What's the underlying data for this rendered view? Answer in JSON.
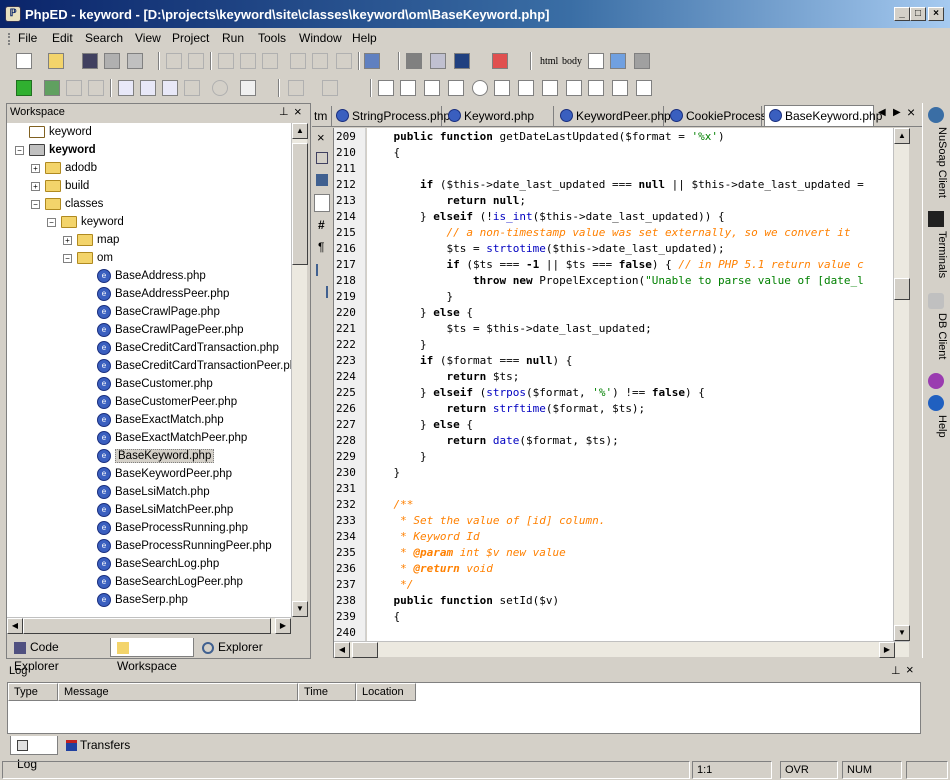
{
  "window": {
    "title": "PhpED - keyword - [D:\\projects\\keyword\\site\\classes\\keyword\\om\\BaseKeyword.php]",
    "min": "_",
    "max": "□",
    "close": "×"
  },
  "menu": [
    "File",
    "Edit",
    "Search",
    "View",
    "Project",
    "Run",
    "Tools",
    "Window",
    "Help"
  ],
  "toolbar_text": {
    "html": "html",
    "body": "body"
  },
  "workspace": {
    "title": "Workspace",
    "tree": [
      {
        "label": "keyword",
        "type": "root",
        "indent": 0
      },
      {
        "label": "keyword",
        "type": "project",
        "indent": 0,
        "bold": true
      },
      {
        "label": "adodb",
        "type": "folder",
        "indent": 1
      },
      {
        "label": "build",
        "type": "folder",
        "indent": 1
      },
      {
        "label": "classes",
        "type": "folder",
        "indent": 1
      },
      {
        "label": "keyword",
        "type": "folder",
        "indent": 2
      },
      {
        "label": "map",
        "type": "folder",
        "indent": 3
      },
      {
        "label": "om",
        "type": "folder",
        "indent": 3
      },
      {
        "label": "BaseAddress.php",
        "type": "file",
        "indent": 4
      },
      {
        "label": "BaseAddressPeer.php",
        "type": "file",
        "indent": 4
      },
      {
        "label": "BaseCrawlPage.php",
        "type": "file",
        "indent": 4
      },
      {
        "label": "BaseCrawlPagePeer.php",
        "type": "file",
        "indent": 4
      },
      {
        "label": "BaseCreditCardTransaction.php",
        "type": "file",
        "indent": 4
      },
      {
        "label": "BaseCreditCardTransactionPeer.php",
        "type": "file",
        "indent": 4
      },
      {
        "label": "BaseCustomer.php",
        "type": "file",
        "indent": 4
      },
      {
        "label": "BaseCustomerPeer.php",
        "type": "file",
        "indent": 4
      },
      {
        "label": "BaseExactMatch.php",
        "type": "file",
        "indent": 4
      },
      {
        "label": "BaseExactMatchPeer.php",
        "type": "file",
        "indent": 4
      },
      {
        "label": "BaseKeyword.php",
        "type": "file",
        "indent": 4,
        "selected": true
      },
      {
        "label": "BaseKeywordPeer.php",
        "type": "file",
        "indent": 4
      },
      {
        "label": "BaseLsiMatch.php",
        "type": "file",
        "indent": 4
      },
      {
        "label": "BaseLsiMatchPeer.php",
        "type": "file",
        "indent": 4
      },
      {
        "label": "BaseProcessRunning.php",
        "type": "file",
        "indent": 4
      },
      {
        "label": "BaseProcessRunningPeer.php",
        "type": "file",
        "indent": 4
      },
      {
        "label": "BaseSearchLog.php",
        "type": "file",
        "indent": 4
      },
      {
        "label": "BaseSearchLogPeer.php",
        "type": "file",
        "indent": 4
      },
      {
        "label": "BaseSerp.php",
        "type": "file",
        "indent": 4
      }
    ],
    "bottom_tabs": [
      "Code Explorer",
      "Workspace",
      "Explorer"
    ]
  },
  "editor": {
    "tabs": [
      "tm",
      "StringProcess.php",
      "Keyword.php",
      "KeywordPeer.php",
      "CookieProcess.php",
      "BaseKeyword.php"
    ],
    "active_tab": "BaseKeyword.php",
    "lines": [
      {
        "n": "209",
        "html": "    <span class=\"kw\">public function</span> getDateLastUpdated($format = <span class=\"st\">'%x'</span>)"
      },
      {
        "n": "210",
        "html": "    {"
      },
      {
        "n": "211",
        "html": ""
      },
      {
        "n": "212",
        "html": "        <span class=\"kw\">if</span> ($this-&gt;date_last_updated === <span class=\"kw\">null</span> || $this-&gt;date_last_updated ="
      },
      {
        "n": "213",
        "html": "            <span class=\"kw\">return null</span>;"
      },
      {
        "n": "214",
        "html": "        } <span class=\"kw\">elseif</span> (!<span class=\"fn\">is_int</span>($this-&gt;date_last_updated)) {"
      },
      {
        "n": "215",
        "html": "            <span class=\"cm\">// a non-timestamp value was set externally, so we convert it</span>"
      },
      {
        "n": "216",
        "html": "            $ts = <span class=\"fn\">strtotime</span>($this-&gt;date_last_updated);"
      },
      {
        "n": "217",
        "html": "            <span class=\"kw\">if</span> ($ts === <span class=\"kw\">-1</span> || $ts === <span class=\"kw\">false</span>) { <span class=\"cm\">// in PHP 5.1 return value c</span>"
      },
      {
        "n": "218",
        "html": "                <span class=\"kw\">throw new</span> PropelException(<span class=\"st\">\"Unable to parse value of [date_l</span>"
      },
      {
        "n": "219",
        "html": "            }"
      },
      {
        "n": "220",
        "html": "        } <span class=\"kw\">else</span> {"
      },
      {
        "n": "221",
        "html": "            $ts = $this-&gt;date_last_updated;"
      },
      {
        "n": "222",
        "html": "        }"
      },
      {
        "n": "223",
        "html": "        <span class=\"kw\">if</span> ($format === <span class=\"kw\">null</span>) {"
      },
      {
        "n": "224",
        "html": "            <span class=\"kw\">return</span> $ts;"
      },
      {
        "n": "225",
        "html": "        } <span class=\"kw\">elseif</span> (<span class=\"fn\">strpos</span>($format, <span class=\"st\">'%'</span>) !== <span class=\"kw\">false</span>) {"
      },
      {
        "n": "226",
        "html": "            <span class=\"kw\">return</span> <span class=\"fn\">strftime</span>($format, $ts);"
      },
      {
        "n": "227",
        "html": "        } <span class=\"kw\">else</span> {"
      },
      {
        "n": "228",
        "html": "            <span class=\"kw\">return</span> <span class=\"fn\">date</span>($format, $ts);"
      },
      {
        "n": "229",
        "html": "        }"
      },
      {
        "n": "230",
        "html": "    }"
      },
      {
        "n": "231",
        "html": ""
      },
      {
        "n": "232",
        "html": "    <span class=\"cm\">/**</span>"
      },
      {
        "n": "233",
        "html": "    <span class=\"cm\"> * Set the value of [id] column.</span>"
      },
      {
        "n": "234",
        "html": "    <span class=\"cm\"> * Keyword Id</span>"
      },
      {
        "n": "235",
        "html": "    <span class=\"cm\"> * <b>@param</b> int $v new value</span>"
      },
      {
        "n": "236",
        "html": "    <span class=\"cm\"> * <b>@return</b> void</span>"
      },
      {
        "n": "237",
        "html": "    <span class=\"cm\"> */</span>"
      },
      {
        "n": "238",
        "html": "    <span class=\"kw\">public function</span> setId($v)"
      },
      {
        "n": "239",
        "html": "    {"
      },
      {
        "n": "240",
        "html": ""
      }
    ]
  },
  "right_rail": [
    "NuSoap Client",
    "Terminals",
    "DB Client",
    "Help"
  ],
  "log": {
    "title": "Log",
    "columns": [
      "Type",
      "Message",
      "Time",
      "Location"
    ],
    "tabs": [
      "Log",
      "Transfers"
    ]
  },
  "status": {
    "position": "1:1",
    "ovr": "OVR",
    "num": "NUM"
  },
  "colors": {
    "title_bar": "#0a246a",
    "selected": "#d4d0c8",
    "comment": "#ff8000"
  }
}
